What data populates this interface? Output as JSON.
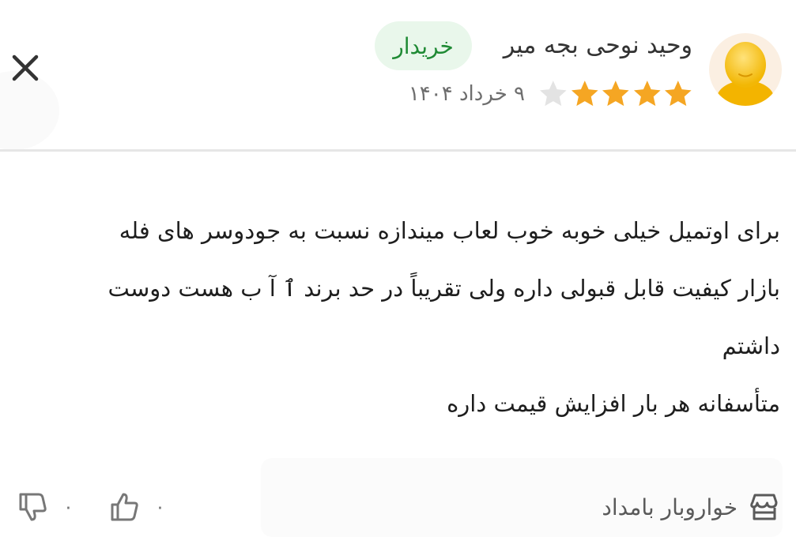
{
  "review": {
    "author_name": "وحید نوحی بجه میر",
    "badge": "خریدار",
    "rating": 4,
    "max_rating": 5,
    "date": "۹ خرداد ۱۴۰۴",
    "lines": [
      "برای اوتمیل خیلی خوبه خوب لعاب میندازه نسبت به جودوسر های فله",
      "بازار کیفیت قابل قبولی داره ولی تقریباً در حد برند ٱ آ ب هست دوست",
      "داشتم",
      "متأسفانه هر بار افزایش قیمت داره"
    ]
  },
  "footer": {
    "store_name": "خواروبار بامداد",
    "likes": "۰",
    "dislikes": "۰"
  },
  "colors": {
    "star_filled": "#f5a623",
    "star_empty": "#e3e3e3",
    "badge_bg": "#e9f7eb",
    "badge_text": "#1f8a34"
  },
  "icons": {
    "close": "close-icon",
    "store": "store-icon",
    "like": "thumbs-up-icon",
    "dislike": "thumbs-down-icon",
    "star": "star-icon"
  }
}
